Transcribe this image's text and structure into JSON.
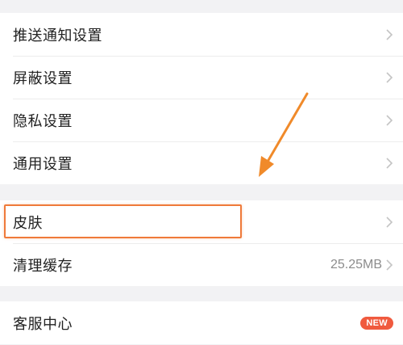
{
  "settings": {
    "push_notifications": "推送通知设置",
    "block": "屏蔽设置",
    "privacy": "隐私设置",
    "general": "通用设置",
    "skin": "皮肤",
    "clear_cache": "清理缓存",
    "cache_size": "25.25MB",
    "customer_service": "客服中心",
    "new_badge": "NEW"
  },
  "icons": {
    "row_arrow": "chevron-right-icon",
    "annotation": "arrow-annotation"
  },
  "colors": {
    "background": "#f2f2f4",
    "highlight": "#ef7a3a",
    "badge": "#f05a3e",
    "arrow": "#f08a2a"
  }
}
